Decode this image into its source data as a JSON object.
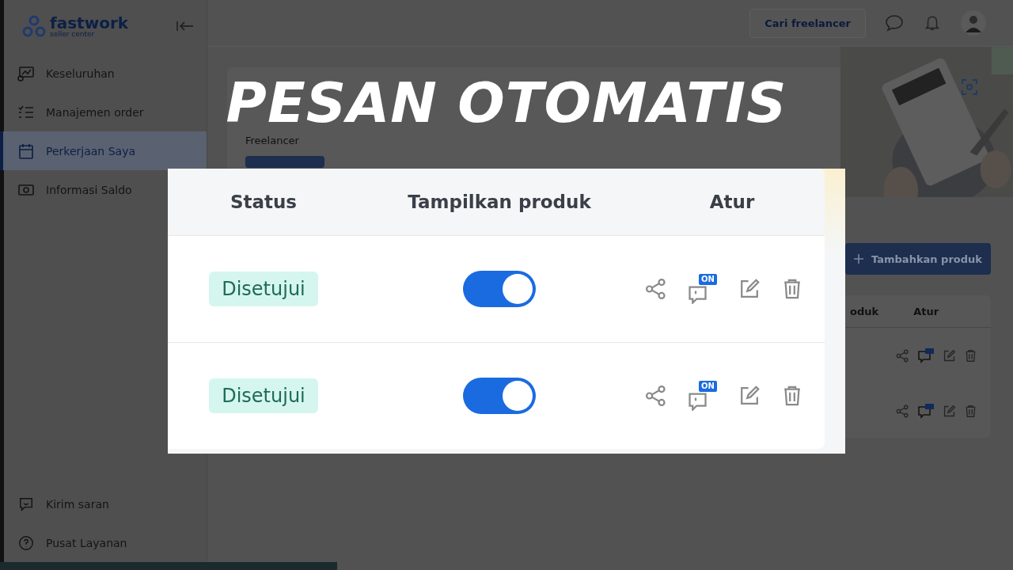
{
  "app": {
    "logo": "fastwork",
    "logo_subtitle": "seller center"
  },
  "sidebar": {
    "items": [
      {
        "label": "Keseluruhan",
        "selected": false
      },
      {
        "label": "Manajemen order",
        "selected": false
      },
      {
        "label": "Perkerjaan Saya",
        "selected": true
      },
      {
        "label": "Informasi Saldo",
        "selected": false
      }
    ],
    "footer_items": [
      {
        "label": "Kirim saran"
      },
      {
        "label": "Pusat Layanan"
      }
    ]
  },
  "topbar": {
    "button": "Cari freelancer"
  },
  "promo": {
    "line": "Freelancer"
  },
  "overlay_title": "PESAN OTOMATIS",
  "bg_table": {
    "button": "Tambahkan produk",
    "columns": [
      "oduk",
      "Atur"
    ],
    "rows": [
      {
        "auto_reply_on": true
      },
      {
        "auto_reply_on": true
      }
    ]
  },
  "inset": {
    "columns": [
      "Status",
      "Tampilkan produk",
      "Atur"
    ],
    "rows": [
      {
        "status": "Disetujui",
        "on": true,
        "auto_reply_badge": "ON"
      },
      {
        "status": "Disetujui",
        "on": true,
        "auto_reply_badge": "ON"
      }
    ]
  }
}
